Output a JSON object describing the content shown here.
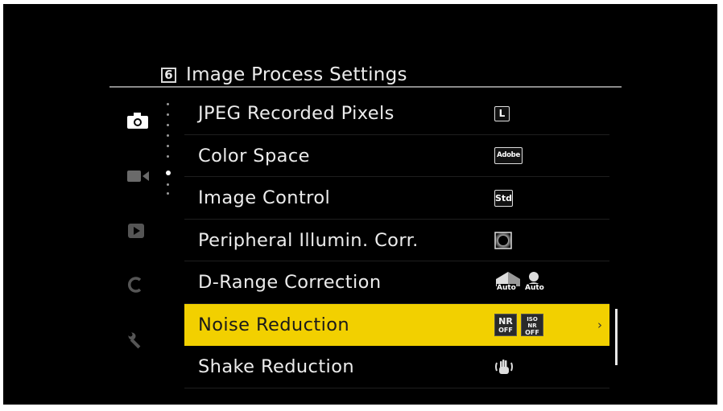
{
  "header": {
    "page_number": "6",
    "title": "Image Process Settings"
  },
  "tabs": [
    {
      "icon": "camera-icon",
      "active": true
    },
    {
      "icon": "video-camera-icon",
      "active": false
    },
    {
      "icon": "playback-icon",
      "active": false
    },
    {
      "icon": "c-custom-icon",
      "active": false
    },
    {
      "icon": "wrench-icon",
      "active": false
    }
  ],
  "menu": {
    "items": [
      {
        "label": "JPEG Recorded Pixels",
        "value": "L",
        "value_icon": "size-l-icon",
        "selected": false
      },
      {
        "label": "Color Space",
        "value": "Adobe",
        "value_icon": "adobe-rgb-icon",
        "selected": false
      },
      {
        "label": "Image Control",
        "value": "Std",
        "value_icon": "standard-icon",
        "selected": false
      },
      {
        "label": "Peripheral Illumin. Corr.",
        "value": "",
        "value_icon": "vignette-icon",
        "selected": false
      },
      {
        "label": "D-Range Correction",
        "value_a": "Auto",
        "value_b": "Auto",
        "value_icon": "d-range-auto-icons",
        "selected": false
      },
      {
        "label": "Noise Reduction",
        "nr_a_top": "NR",
        "nr_a_bottom": "OFF",
        "nr_b_top": "ISO NR",
        "nr_b_bottom": "OFF",
        "value_icon": "noise-reduction-off-icons",
        "chevron": "›",
        "selected": true
      },
      {
        "label": "Shake Reduction",
        "value": "",
        "value_icon": "shake-reduction-icon",
        "selected": false
      }
    ]
  },
  "colors": {
    "highlight": "#f2d000",
    "background": "#000000",
    "text": "#ececec"
  }
}
